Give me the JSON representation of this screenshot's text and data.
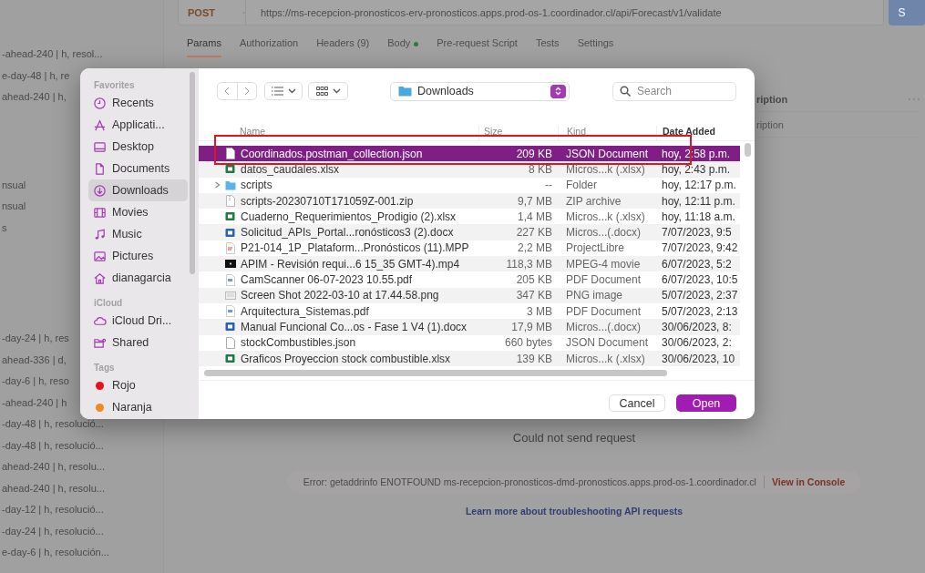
{
  "request_bar": {
    "method": "POST",
    "url": "https://ms-recepcion-pronosticos-erv-pronosticos.apps.prod-os-1.coordinador.cl/api/Forecast/v1/validate",
    "send_label": "S"
  },
  "request_tabs": [
    {
      "label": "Params",
      "selected": true,
      "indicator": false
    },
    {
      "label": "Authorization",
      "selected": false,
      "indicator": false
    },
    {
      "label": "Headers (9)",
      "selected": false,
      "indicator": false
    },
    {
      "label": "Body",
      "selected": false,
      "indicator": true
    },
    {
      "label": "Pre-request Script",
      "selected": false,
      "indicator": false
    },
    {
      "label": "Tests",
      "selected": false,
      "indicator": false
    },
    {
      "label": "Settings",
      "selected": false,
      "indicator": false
    }
  ],
  "sidebar_groups": [
    [
      "-ahead-240 | h, resol...",
      "e-day-48 | h, re",
      "ahead-240 | h,"
    ],
    [
      "nsual",
      "nsual",
      "s"
    ],
    [
      "-day-24 | h, res",
      "ahead-336 | d,",
      "-day-6 | h, reso",
      "-ahead-240 | h",
      "-day-48 | h, resolució...",
      "-day-48 | h, resolució...",
      "ahead-240 | h, resolu...",
      "ahead-240 | h, resolu...",
      "-day-12 | h, resolució...",
      "-day-24 | h, resolució...",
      "e-day-6 | h, resolución..."
    ]
  ],
  "params_table": {
    "column_header": "ription",
    "placeholder": "ription"
  },
  "response": {
    "message": "Could not send request",
    "error": "Error: getaddrinfo ENOTFOUND ms-recepcion-pronosticos-dmd-pronosticos.apps.prod-os-1.coordinador.cl",
    "console_link": "View in Console",
    "help_link": "Learn more about troubleshooting API requests"
  },
  "file_dialog": {
    "sidebar": [
      {
        "heading": "Favorites",
        "items": [
          {
            "label": "Recents",
            "kind": "recents",
            "selected": false
          },
          {
            "label": "Applicati...",
            "kind": "applications",
            "selected": false
          },
          {
            "label": "Desktop",
            "kind": "desktop",
            "selected": false
          },
          {
            "label": "Documents",
            "kind": "documents",
            "selected": false
          },
          {
            "label": "Downloads",
            "kind": "downloads",
            "selected": true
          },
          {
            "label": "Movies",
            "kind": "movies",
            "selected": false
          },
          {
            "label": "Music",
            "kind": "music",
            "selected": false
          },
          {
            "label": "Pictures",
            "kind": "pictures",
            "selected": false
          },
          {
            "label": "dianagarcia",
            "kind": "home",
            "selected": false
          }
        ]
      },
      {
        "heading": "iCloud",
        "items": [
          {
            "label": "iCloud Dri...",
            "kind": "cloud",
            "selected": false
          },
          {
            "label": "Shared",
            "kind": "shared",
            "selected": false
          }
        ]
      },
      {
        "heading": "Tags",
        "items": [
          {
            "label": "Rojo",
            "kind": "tag",
            "color": "#e8101c",
            "selected": false
          },
          {
            "label": "Naranja",
            "kind": "tag",
            "color": "#f08a1c",
            "selected": false
          }
        ]
      }
    ],
    "location": "Downloads",
    "search_placeholder": "Search",
    "columns": [
      {
        "label": "Name",
        "sorted": false
      },
      {
        "label": "Size",
        "sorted": false
      },
      {
        "label": "Kind",
        "sorted": false
      },
      {
        "label": "Date Added",
        "sorted": true
      }
    ],
    "files": [
      {
        "name": "Coordinados.postman_collection.json",
        "size": "209 KB",
        "type_label": "JSON Document",
        "date": "hoy, 2:58 p.m.",
        "kind": "plain",
        "selected": true,
        "expandable": false
      },
      {
        "name": "datos_caudales.xlsx",
        "size": "8 KB",
        "type_label": "Micros...k (.xlsx)",
        "date": "hoy, 2:43 p.m.",
        "kind": "sheet",
        "selected": false,
        "expandable": false
      },
      {
        "name": "scripts",
        "size": "--",
        "type_label": "Folder",
        "date": "hoy, 12:17 p.m.",
        "kind": "folder",
        "selected": false,
        "expandable": true
      },
      {
        "name": "scripts-20230710T171059Z-001.zip",
        "size": "9,7 MB",
        "type_label": "ZIP archive",
        "date": "hoy, 12:11 p.m.",
        "kind": "zip",
        "selected": false,
        "expandable": false
      },
      {
        "name": "Cuaderno_Requerimientos_Prodigio (2).xlsx",
        "size": "1,4 MB",
        "type_label": "Micros...k (.xlsx)",
        "date": "hoy, 11:18 a.m.",
        "kind": "sheet",
        "selected": false,
        "expandable": false
      },
      {
        "name": "Solicitud_APIs_Portal...ronósticos3 (2).docx",
        "size": "227 KB",
        "type_label": "Micros...(.docx)",
        "date": "7/07/2023, 9:5",
        "kind": "word",
        "selected": false,
        "expandable": false
      },
      {
        "name": "P21-014_1P_Plataform...Pronósticos (11).MPP",
        "size": "2,2 MB",
        "type_label": "ProjectLibre",
        "date": "7/07/2023, 9:42",
        "kind": "project",
        "selected": false,
        "expandable": false
      },
      {
        "name": "APIM - Revisión requi...6 15_35 GMT-4).mp4",
        "size": "118,3 MB",
        "type_label": "MPEG-4 movie",
        "date": "6/07/2023, 5:2",
        "kind": "video",
        "selected": false,
        "expandable": false
      },
      {
        "name": "CamScanner 06-07-2023 10.55.pdf",
        "size": "205 KB",
        "type_label": "PDF Document",
        "date": "6/07/2023, 10:5",
        "kind": "pdf",
        "selected": false,
        "expandable": false
      },
      {
        "name": "Screen Shot 2022-03-10 at 17.44.58.png",
        "size": "347 KB",
        "type_label": "PNG image",
        "date": "5/07/2023, 2:37",
        "kind": "image",
        "selected": false,
        "expandable": false
      },
      {
        "name": "Arquitectura_Sistemas.pdf",
        "size": "3 MB",
        "type_label": "PDF Document",
        "date": "5/07/2023, 2:13",
        "kind": "pdf",
        "selected": false,
        "expandable": false
      },
      {
        "name": "Manual Funcional Co...os - Fase 1 V4 (1).docx",
        "size": "17,9 MB",
        "type_label": "Micros...(.docx)",
        "date": "30/06/2023, 8:",
        "kind": "word",
        "selected": false,
        "expandable": false
      },
      {
        "name": "stockCombustibles.json",
        "size": "660 bytes",
        "type_label": "JSON Document",
        "date": "30/06/2023, 2:",
        "kind": "plain",
        "selected": false,
        "expandable": false
      },
      {
        "name": "Graficos Proyeccion stock combustible.xlsx",
        "size": "139 KB",
        "type_label": "Micros...k (.xlsx)",
        "date": "30/06/2023, 10",
        "kind": "sheet",
        "selected": false,
        "expandable": false
      }
    ],
    "buttons": [
      {
        "label": "Cancel",
        "kind": "secondary"
      },
      {
        "label": "Open",
        "kind": "primary"
      }
    ]
  }
}
